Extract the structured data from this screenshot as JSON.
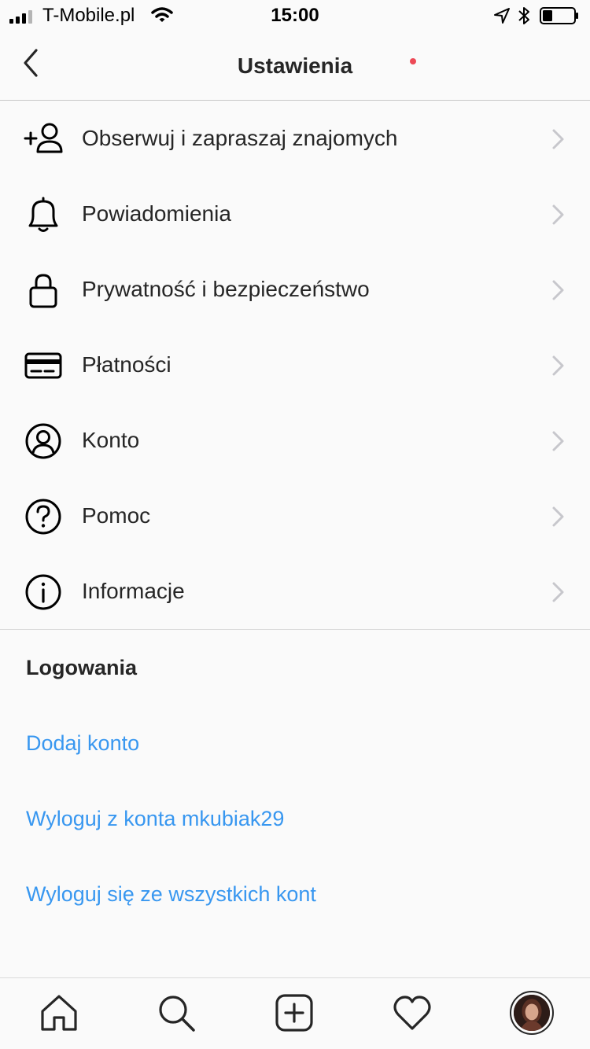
{
  "status_bar": {
    "carrier": "T-Mobile.pl",
    "time": "15:00"
  },
  "nav": {
    "title": "Ustawienia"
  },
  "menu": [
    {
      "label": "Obserwuj i zapraszaj znajomych",
      "icon": "add-person-icon"
    },
    {
      "label": "Powiadomienia",
      "icon": "bell-icon"
    },
    {
      "label": "Prywatność i bezpieczeństwo",
      "icon": "lock-icon"
    },
    {
      "label": "Płatności",
      "icon": "credit-card-icon"
    },
    {
      "label": "Konto",
      "icon": "account-circle-icon"
    },
    {
      "label": "Pomoc",
      "icon": "help-circle-icon"
    },
    {
      "label": "Informacje",
      "icon": "info-circle-icon"
    }
  ],
  "logins": {
    "title": "Logowania",
    "add_account": "Dodaj konto",
    "logout_account": "Wyloguj z konta mkubiak29",
    "logout_all": "Wyloguj się ze wszystkich kont"
  },
  "tab_bar": {
    "items": [
      "home-icon",
      "search-icon",
      "add-post-icon",
      "heart-icon",
      "profile-avatar"
    ],
    "activity_has_notification": true
  },
  "colors": {
    "link": "#3897f0",
    "text": "#262626",
    "background": "#fafafa",
    "notification_dot": "#ed4956"
  }
}
